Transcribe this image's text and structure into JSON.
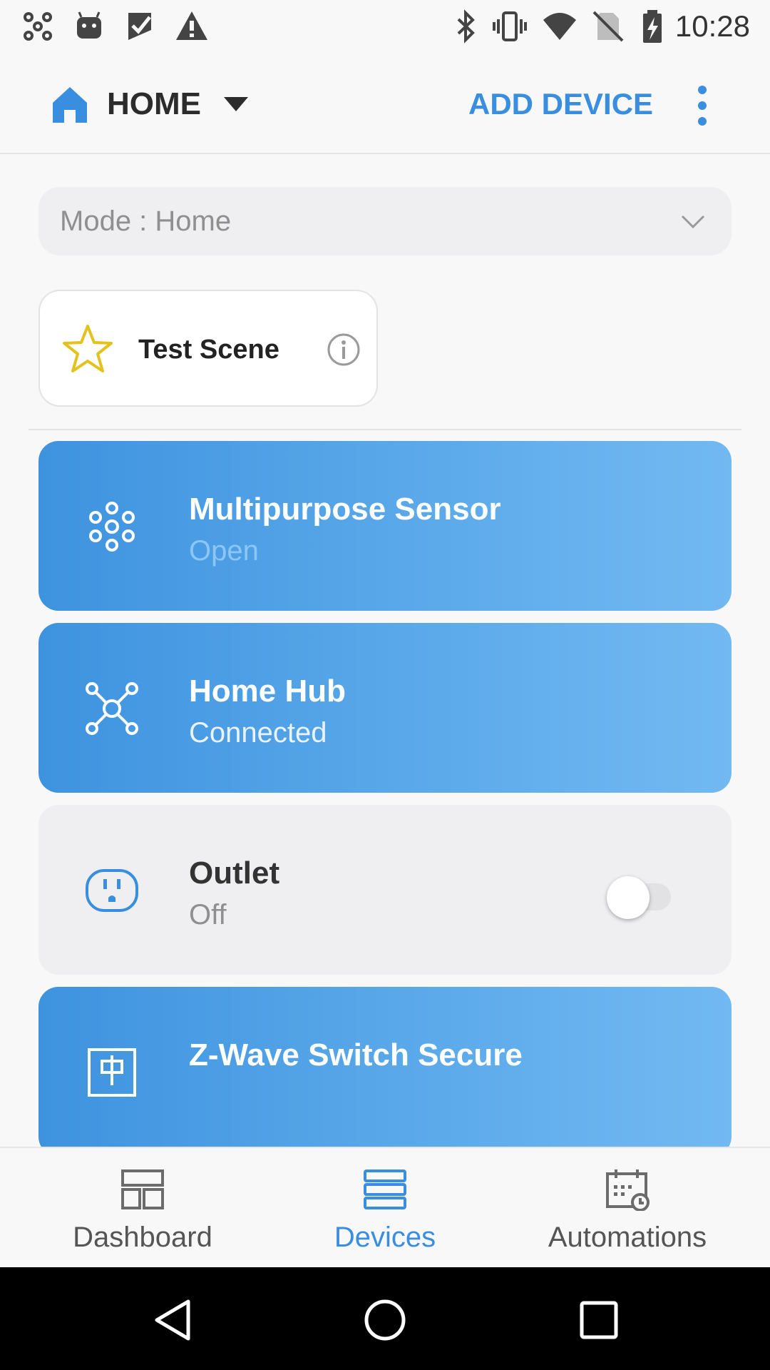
{
  "status_bar": {
    "time": "10:28",
    "left_icons": [
      "hub-icon",
      "android-icon",
      "play-store-icon",
      "warning-icon"
    ],
    "right_icons": [
      "bluetooth-icon",
      "vibrate-icon",
      "wifi-icon",
      "no-sim-icon",
      "battery-charging-icon"
    ]
  },
  "header": {
    "location_title": "HOME",
    "add_device_label": "ADD DEVICE"
  },
  "mode_selector": {
    "label": "Mode : Home"
  },
  "scene": {
    "label": "Test Scene"
  },
  "devices": [
    {
      "name": "Multipurpose Sensor",
      "status": "Open",
      "icon": "sensor-icon",
      "active": true
    },
    {
      "name": "Home Hub",
      "status": "Connected",
      "icon": "hub-icon",
      "active": true
    },
    {
      "name": "Outlet",
      "status": "Off",
      "icon": "outlet-icon",
      "active": false,
      "toggle_on": false
    },
    {
      "name": "Z-Wave Switch Secure",
      "status": "",
      "icon": "switch-icon",
      "active": true
    }
  ],
  "bottom_nav": {
    "items": [
      {
        "label": "Dashboard",
        "active": false
      },
      {
        "label": "Devices",
        "active": true
      },
      {
        "label": "Automations",
        "active": false
      }
    ]
  },
  "colors": {
    "accent": "#3a8ee0",
    "card_gradient_start": "#3e93df",
    "card_gradient_end": "#72b9f2",
    "inactive_card": "#efeff1",
    "star": "#e4c21e"
  }
}
